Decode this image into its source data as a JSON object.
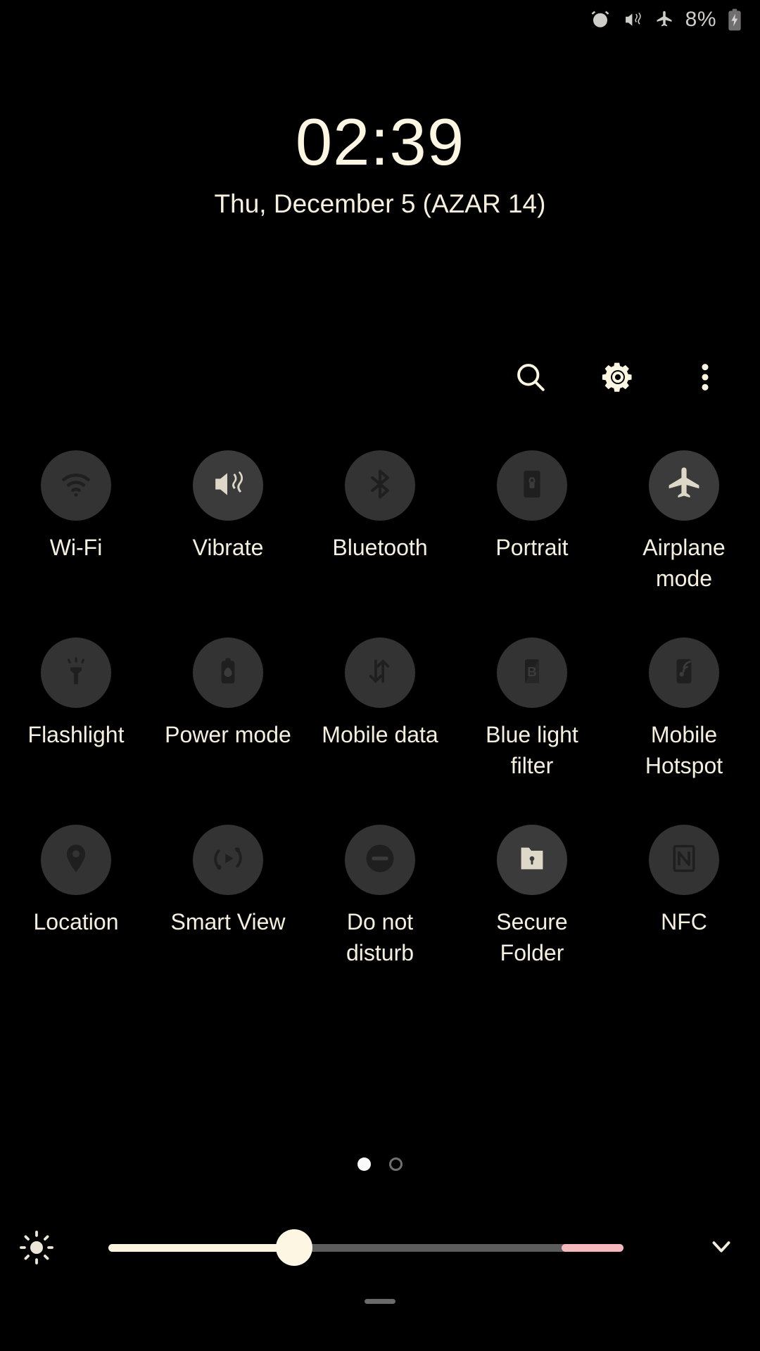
{
  "statusbar": {
    "icons": [
      "alarm-icon",
      "vibrate-icon",
      "airplane-icon"
    ],
    "battery_percent": "8%",
    "battery_state": "charging"
  },
  "clock": {
    "time": "02:39",
    "date": "Thu, December 5 (AZAR 14)"
  },
  "header": {
    "search_label": "search-icon",
    "settings_label": "gear-icon",
    "more_label": "more-vertical-icon"
  },
  "tiles": {
    "rows": [
      [
        {
          "label": "Wi-Fi",
          "icon": "wifi-icon",
          "state": "off"
        },
        {
          "label": "Vibrate",
          "icon": "vibrate-icon",
          "state": "on"
        },
        {
          "label": "Bluetooth",
          "icon": "bluetooth-icon",
          "state": "off"
        },
        {
          "label": "Portrait",
          "icon": "rotation-lock-icon",
          "state": "off"
        },
        {
          "label": "Airplane mode",
          "icon": "airplane-icon",
          "state": "on"
        }
      ],
      [
        {
          "label": "Flashlight",
          "icon": "flashlight-icon",
          "state": "off"
        },
        {
          "label": "Power mode",
          "icon": "power-mode-icon",
          "state": "off"
        },
        {
          "label": "Mobile data",
          "icon": "mobile-data-icon",
          "state": "off"
        },
        {
          "label": "Blue light filter",
          "icon": "blue-light-filter-icon",
          "state": "off"
        },
        {
          "label": "Mobile Hotspot",
          "icon": "hotspot-icon",
          "state": "off"
        }
      ],
      [
        {
          "label": "Location",
          "icon": "location-pin-icon",
          "state": "off"
        },
        {
          "label": "Smart View",
          "icon": "smart-view-icon",
          "state": "off"
        },
        {
          "label": "Do not disturb",
          "icon": "do-not-disturb-icon",
          "state": "off"
        },
        {
          "label": "Secure Folder",
          "icon": "secure-folder-icon",
          "state": "on"
        },
        {
          "label": "NFC",
          "icon": "nfc-icon",
          "state": "off"
        }
      ]
    ]
  },
  "pager": {
    "total_pages": 2,
    "current_page": 1
  },
  "brightness": {
    "icon": "brightness-icon",
    "value_percent": 36,
    "warn_zone_start_percent": 88,
    "expand_label": "chevron-down-icon"
  },
  "colors": {
    "background": "#000000",
    "text_primary": "#f7f0df",
    "accent_cream": "#fdf6e3",
    "tile_off_bg": "#333333",
    "icon_off": "#1f1f1f",
    "slider_track": "#5c5c5c",
    "slider_warn": "#f6b7bd"
  }
}
